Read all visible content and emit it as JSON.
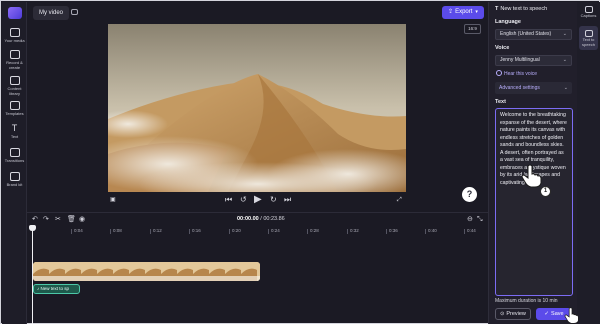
{
  "top": {
    "tab_label": "My video",
    "export_label": "Export"
  },
  "left_nav": [
    {
      "label": "Your media",
      "icon": "folder-icon"
    },
    {
      "label": "Record & create",
      "icon": "camera-icon"
    },
    {
      "label": "Content library",
      "icon": "library-icon"
    },
    {
      "label": "Templates",
      "icon": "templates-icon"
    },
    {
      "label": "Text",
      "icon": "text-icon"
    },
    {
      "label": "Transitions",
      "icon": "transitions-icon"
    },
    {
      "label": "Brand kit",
      "icon": "brand-kit-icon"
    }
  ],
  "preview": {
    "aspect_ratio": "16:9"
  },
  "timeline": {
    "current_time": "00:00.00",
    "total_time": "00:23.86",
    "ticks": [
      "0:04",
      "0:08",
      "0:12",
      "0:16",
      "0:20",
      "0:24",
      "0:28",
      "0:32",
      "0:36",
      "0:40",
      "0:44"
    ],
    "tts_clip_label": "New text to sp"
  },
  "panel": {
    "title": "New text to speech",
    "language_label": "Language",
    "language_value": "English (United States)",
    "voice_label": "Voice",
    "voice_value": "Jenny Multilingual",
    "hear_voice": "Hear this voice",
    "advanced": "Advanced settings",
    "text_label": "Text",
    "text_value": "Welcome to the breathtaking expanse of the desert, where nature paints its canvas with endless stretches of golden sands and boundless skies. A desert, often portrayed as a vast sea of tranquility, embraces a mystique woven by its arid landscapes and captivating",
    "max_duration": "Maximum duration is 10 min",
    "preview_label": "Preview",
    "save_label": "Save"
  },
  "right_strip": [
    {
      "label": "Captions",
      "icon": "captions-icon"
    },
    {
      "label": "Text to speech",
      "icon": "text-to-speech-icon"
    }
  ],
  "step_badge": "1",
  "colors": {
    "accent": "#5b4bea",
    "background": "#1b1a24",
    "tts_clip": "#1e5a4c"
  }
}
